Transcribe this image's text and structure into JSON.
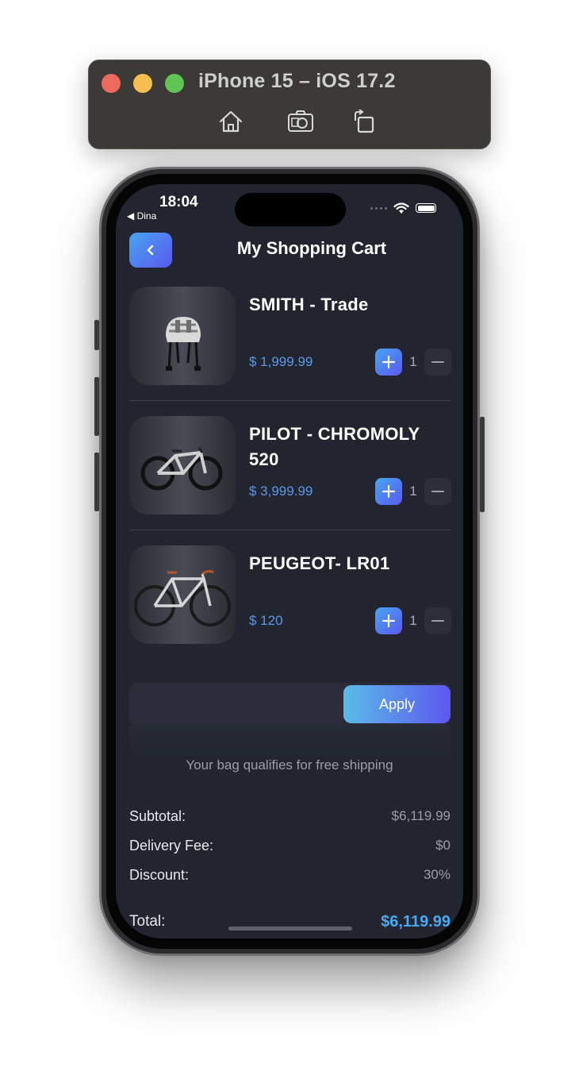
{
  "simulator": {
    "title": "iPhone 15 – iOS 17.2",
    "icons": [
      "home-icon",
      "screenshot-icon",
      "rotate-icon"
    ]
  },
  "status_bar": {
    "time": "18:04",
    "back_app": "◀ Dina"
  },
  "header": {
    "title": "My Shopping Cart",
    "back_icon": "chevron-left-icon"
  },
  "cart": {
    "items": [
      {
        "name": "SMITH - Trade",
        "price": "$ 1,999.99",
        "quantity": "1",
        "image": "helmet"
      },
      {
        "name": "PILOT - CHROMOLY 520",
        "price": "$ 3,999.99",
        "quantity": "1",
        "image": "e-bike"
      },
      {
        "name": "PEUGEOT- LR01",
        "price": "$ 120",
        "quantity": "1",
        "image": "road-bike"
      }
    ]
  },
  "promo": {
    "code_value": "",
    "apply_label": "Apply"
  },
  "shipping_note": "Your bag qualifies for free shipping",
  "summary": {
    "subtotal_label": "Subtotal:",
    "subtotal_value": "$6,119.99",
    "delivery_label": "Delivery Fee:",
    "delivery_value": "$0",
    "discount_label": "Discount:",
    "discount_value": "30%",
    "total_label": "Total:",
    "total_value": "$6,119.99"
  },
  "colors": {
    "background": "#22252f",
    "accent_start": "#46a5f0",
    "accent_end": "#5c58ef",
    "price": "#5b97e6",
    "total": "#4aa8f0"
  }
}
